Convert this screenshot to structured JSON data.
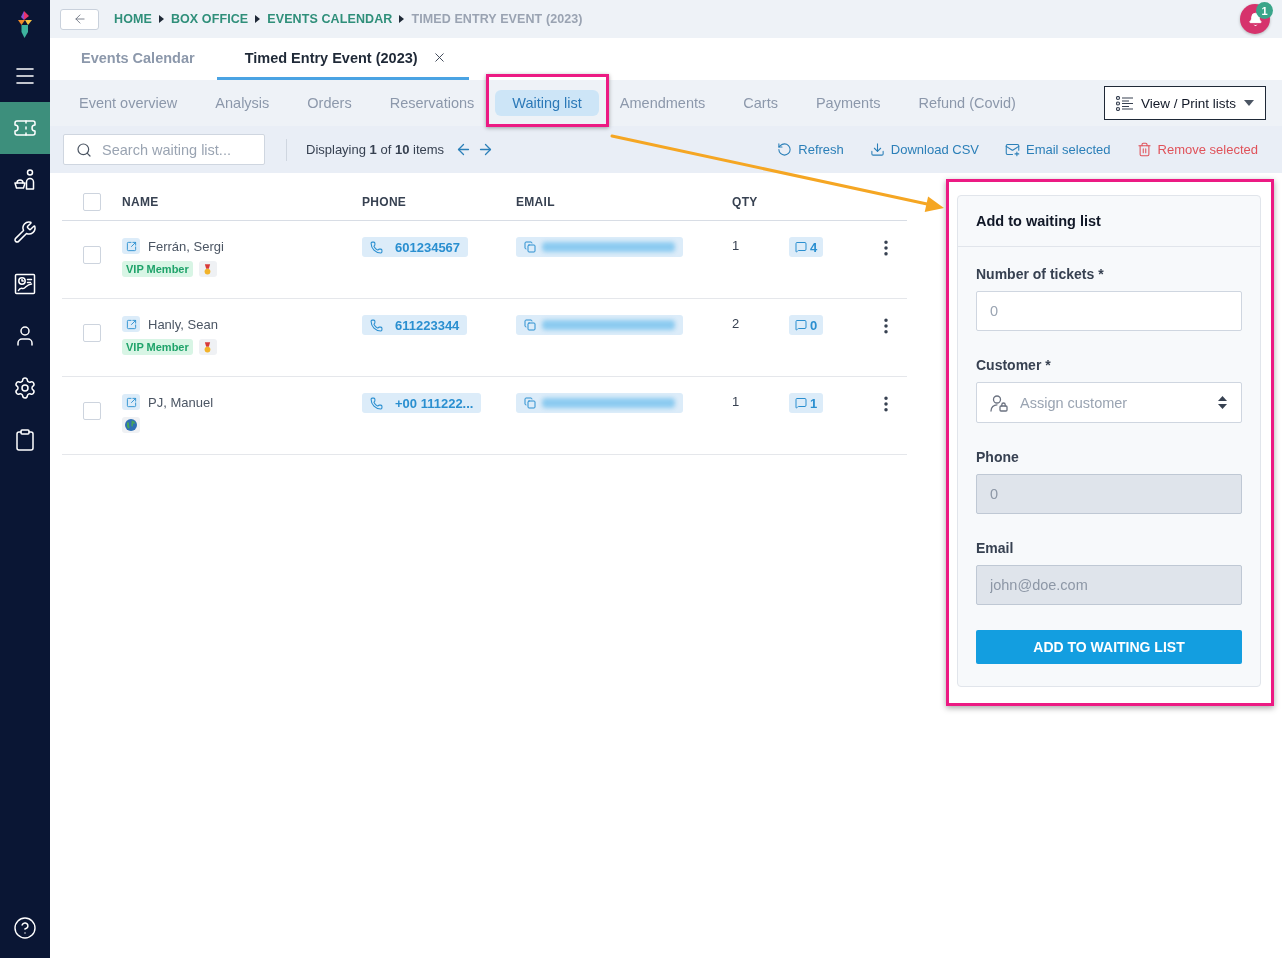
{
  "sidebar": {
    "items": [
      {
        "selected": true
      },
      {
        "selected": false
      },
      {
        "selected": false
      },
      {
        "selected": false
      },
      {
        "selected": false
      },
      {
        "selected": false
      },
      {
        "selected": false
      }
    ]
  },
  "breadcrumb": [
    {
      "label": "HOME",
      "current": false
    },
    {
      "label": "BOX OFFICE",
      "current": false
    },
    {
      "label": "EVENTS CALENDAR",
      "current": false
    },
    {
      "label": "TIMED ENTRY EVENT (2023)",
      "current": true
    }
  ],
  "notifications": {
    "count": "1"
  },
  "tabs": [
    {
      "label": "Events Calendar",
      "selected": false,
      "closable": false
    },
    {
      "label": "Timed Entry Event (2023)",
      "selected": true,
      "closable": true
    }
  ],
  "subnav": {
    "items": [
      {
        "label": "Event overview",
        "selected": false,
        "highlighted": false
      },
      {
        "label": "Analysis",
        "selected": false,
        "highlighted": false
      },
      {
        "label": "Orders",
        "selected": false,
        "highlighted": false
      },
      {
        "label": "Reservations",
        "selected": false,
        "highlighted": false
      },
      {
        "label": "Waiting list",
        "selected": true,
        "highlighted": true
      },
      {
        "label": "Amendments",
        "selected": false,
        "highlighted": false
      },
      {
        "label": "Carts",
        "selected": false,
        "highlighted": false
      },
      {
        "label": "Payments",
        "selected": false,
        "highlighted": false
      },
      {
        "label": "Refund (Covid)",
        "selected": false,
        "highlighted": false
      }
    ],
    "view_button": {
      "label": "View / Print lists"
    }
  },
  "toolbar": {
    "search": {
      "placeholder": "Search waiting list..."
    },
    "display": "Displaying **1** of **10** items",
    "actions": [
      {
        "label": "Refresh",
        "danger": false
      },
      {
        "label": "Download CSV",
        "danger": false
      },
      {
        "label": "Email selected",
        "danger": false
      },
      {
        "label": "Remove selected",
        "danger": true
      }
    ]
  },
  "table": {
    "select_all": {
      "checked": false
    },
    "columns": [
      "NAME",
      "PHONE",
      "EMAIL",
      "QTY"
    ],
    "rows": [
      {
        "checked": false,
        "name": "Ferrán, Sergi",
        "badges": [
          {
            "kind": "tag",
            "label": "VIP Member"
          },
          {
            "kind": "medal"
          }
        ],
        "phone": "601234567",
        "qty": "1",
        "comments": "4"
      },
      {
        "checked": false,
        "name": "Hanly, Sean",
        "badges": [
          {
            "kind": "tag",
            "label": "VIP Member"
          },
          {
            "kind": "medal"
          }
        ],
        "phone": "611223344",
        "qty": "2",
        "comments": "0"
      },
      {
        "checked": false,
        "name": "PJ, Manuel",
        "badges": [
          {
            "kind": "globe"
          }
        ],
        "phone": "+00 111222...",
        "qty": "1",
        "comments": "1"
      }
    ]
  },
  "panel": {
    "title": "Add to waiting list",
    "highlighted": true,
    "fields": [
      {
        "kind": "input",
        "label": "Number of tickets *",
        "placeholder": "0",
        "disabled": false
      },
      {
        "kind": "select",
        "label": "Customer *",
        "placeholder": "Assign customer",
        "disabled": false
      },
      {
        "kind": "input",
        "label": "Phone",
        "placeholder": "0",
        "disabled": true
      },
      {
        "kind": "input",
        "label": "Email",
        "placeholder": "john@doe.com",
        "disabled": true
      }
    ],
    "submit": "ADD TO WAITING LIST"
  },
  "annotation_arrow": true
}
